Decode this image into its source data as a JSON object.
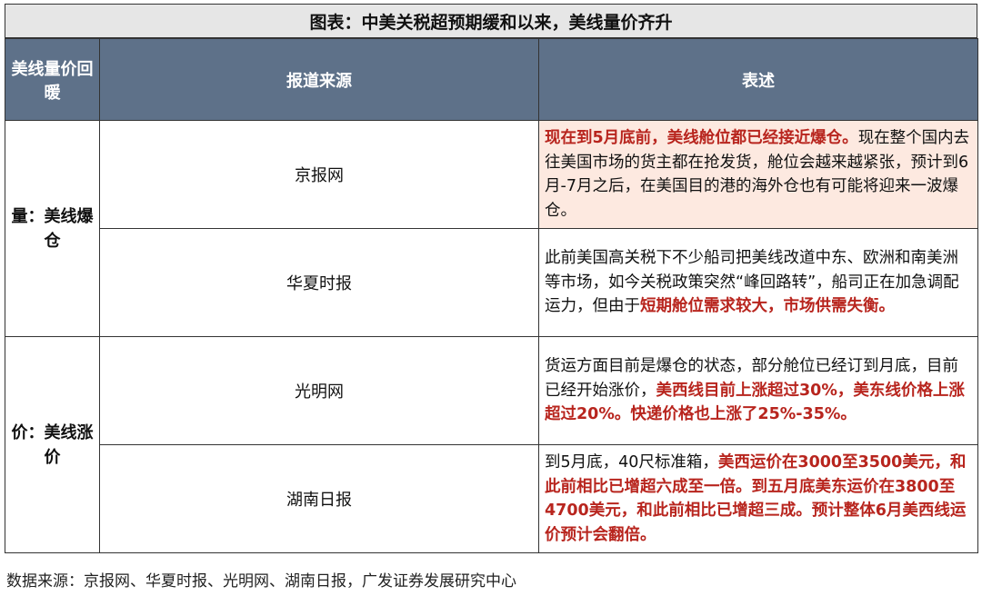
{
  "title": "图表：中美关税超预期缓和以来，美线量价齐升",
  "header": {
    "col1": "美线量价回暖",
    "col2": "报道来源",
    "col3": "表述"
  },
  "rows": [
    {
      "category": "量：美线爆仓",
      "source": "京报网",
      "desc": [
        {
          "text": "现在到5月底前，美线舱位都已经接近爆仓。",
          "red": true
        },
        {
          "text": "现在整个国内去往美国市场的货主都在抢发货，舱位会越来越紧张，预计到6月-7月之后，在美国目的港的海外仓也有可能将迎来一波爆仓。",
          "red": false
        }
      ]
    },
    {
      "source": "华夏时报",
      "desc": [
        {
          "text": "此前美国高关税下不少船司把美线改道中东、欧洲和南美洲等市场，如今关税政策突然“峰回路转”，船司正在加急调配运力，但由于",
          "red": false
        },
        {
          "text": "短期舱位需求较大，市场供需失衡。",
          "red": true
        }
      ]
    },
    {
      "category": "价：美线涨价",
      "source": "光明网",
      "desc": [
        {
          "text": "货运方面目前是爆仓的状态，部分舱位已经订到月底，目前已经开始涨价，",
          "red": false
        },
        {
          "text": "美西线目前上涨超过30%，美东线价格上涨超过20%。快递价格也上涨了25%-35%。",
          "red": true
        }
      ]
    },
    {
      "source": "湖南日报",
      "desc": [
        {
          "text": "到5月底，40尺标准箱，",
          "red": false
        },
        {
          "text": "美西运价在3000至3500美元，和此前相比已增超六成至一倍。到五月底美东运价在3800至4700美元，和此前相比已增超三成。预计整体6月美西线运价预计会翻倍。",
          "red": true
        }
      ]
    }
  ],
  "footnote": "数据来源：京报网、华夏时报、光明网、湖南日报，广发证券发展研究中心",
  "colors": {
    "header_bg": "#5e7189",
    "title_bg": "#e6e6e6",
    "highlight_red": "#b8251e",
    "highlight_bg": "#fde9e0"
  }
}
